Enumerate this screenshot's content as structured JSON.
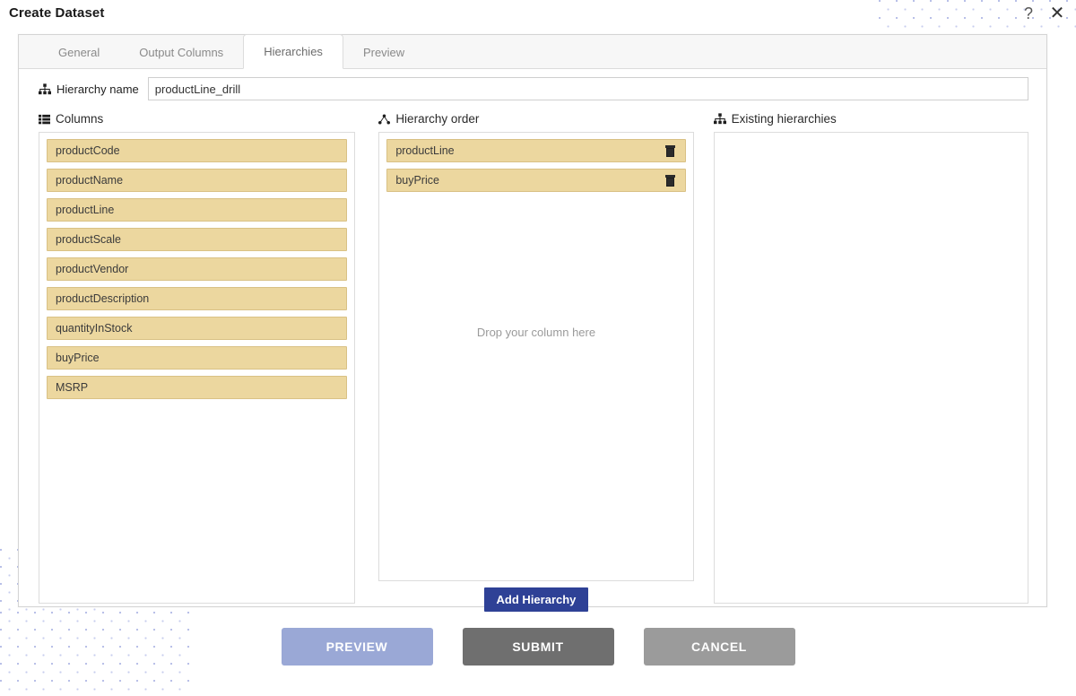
{
  "dialog": {
    "title": "Create Dataset",
    "help_icon": "?",
    "close_icon": "✕"
  },
  "tabs": [
    {
      "label": "General",
      "active": false
    },
    {
      "label": "Output Columns",
      "active": false
    },
    {
      "label": "Hierarchies",
      "active": true
    },
    {
      "label": "Preview",
      "active": false
    }
  ],
  "hierarchy_name": {
    "icon": "sitemap-icon",
    "label": "Hierarchy name",
    "value": "productLine_drill",
    "placeholder": ""
  },
  "columns_panel": {
    "icon": "list-icon",
    "title": "Columns",
    "items": [
      "productCode",
      "productName",
      "productLine",
      "productScale",
      "productVendor",
      "productDescription",
      "quantityInStock",
      "buyPrice",
      "MSRP"
    ]
  },
  "hierarchy_order_panel": {
    "icon": "share-nodes-icon",
    "title": "Hierarchy order",
    "items": [
      {
        "label": "productLine",
        "delete_icon": "trash-icon"
      },
      {
        "label": "buyPrice",
        "delete_icon": "trash-icon"
      }
    ],
    "drop_hint": "Drop your column here",
    "add_button_label": "Add Hierarchy"
  },
  "existing_panel": {
    "icon": "sitemap-icon",
    "title": "Existing hierarchies",
    "items": []
  },
  "footer": {
    "buttons": [
      {
        "label": "PREVIEW",
        "name": "preview-button"
      },
      {
        "label": "SUBMIT",
        "name": "submit-button"
      },
      {
        "label": "CANCEL",
        "name": "cancel-button"
      }
    ]
  },
  "colors": {
    "chip_fill": "#ecd79f",
    "chip_border": "#d9c185",
    "add_button": "#2e4196",
    "preview_button": "#9aa8d6",
    "submit_button": "#6f6f6f",
    "cancel_button": "#9b9b9b",
    "dot_pattern": "#b9c0e8"
  }
}
